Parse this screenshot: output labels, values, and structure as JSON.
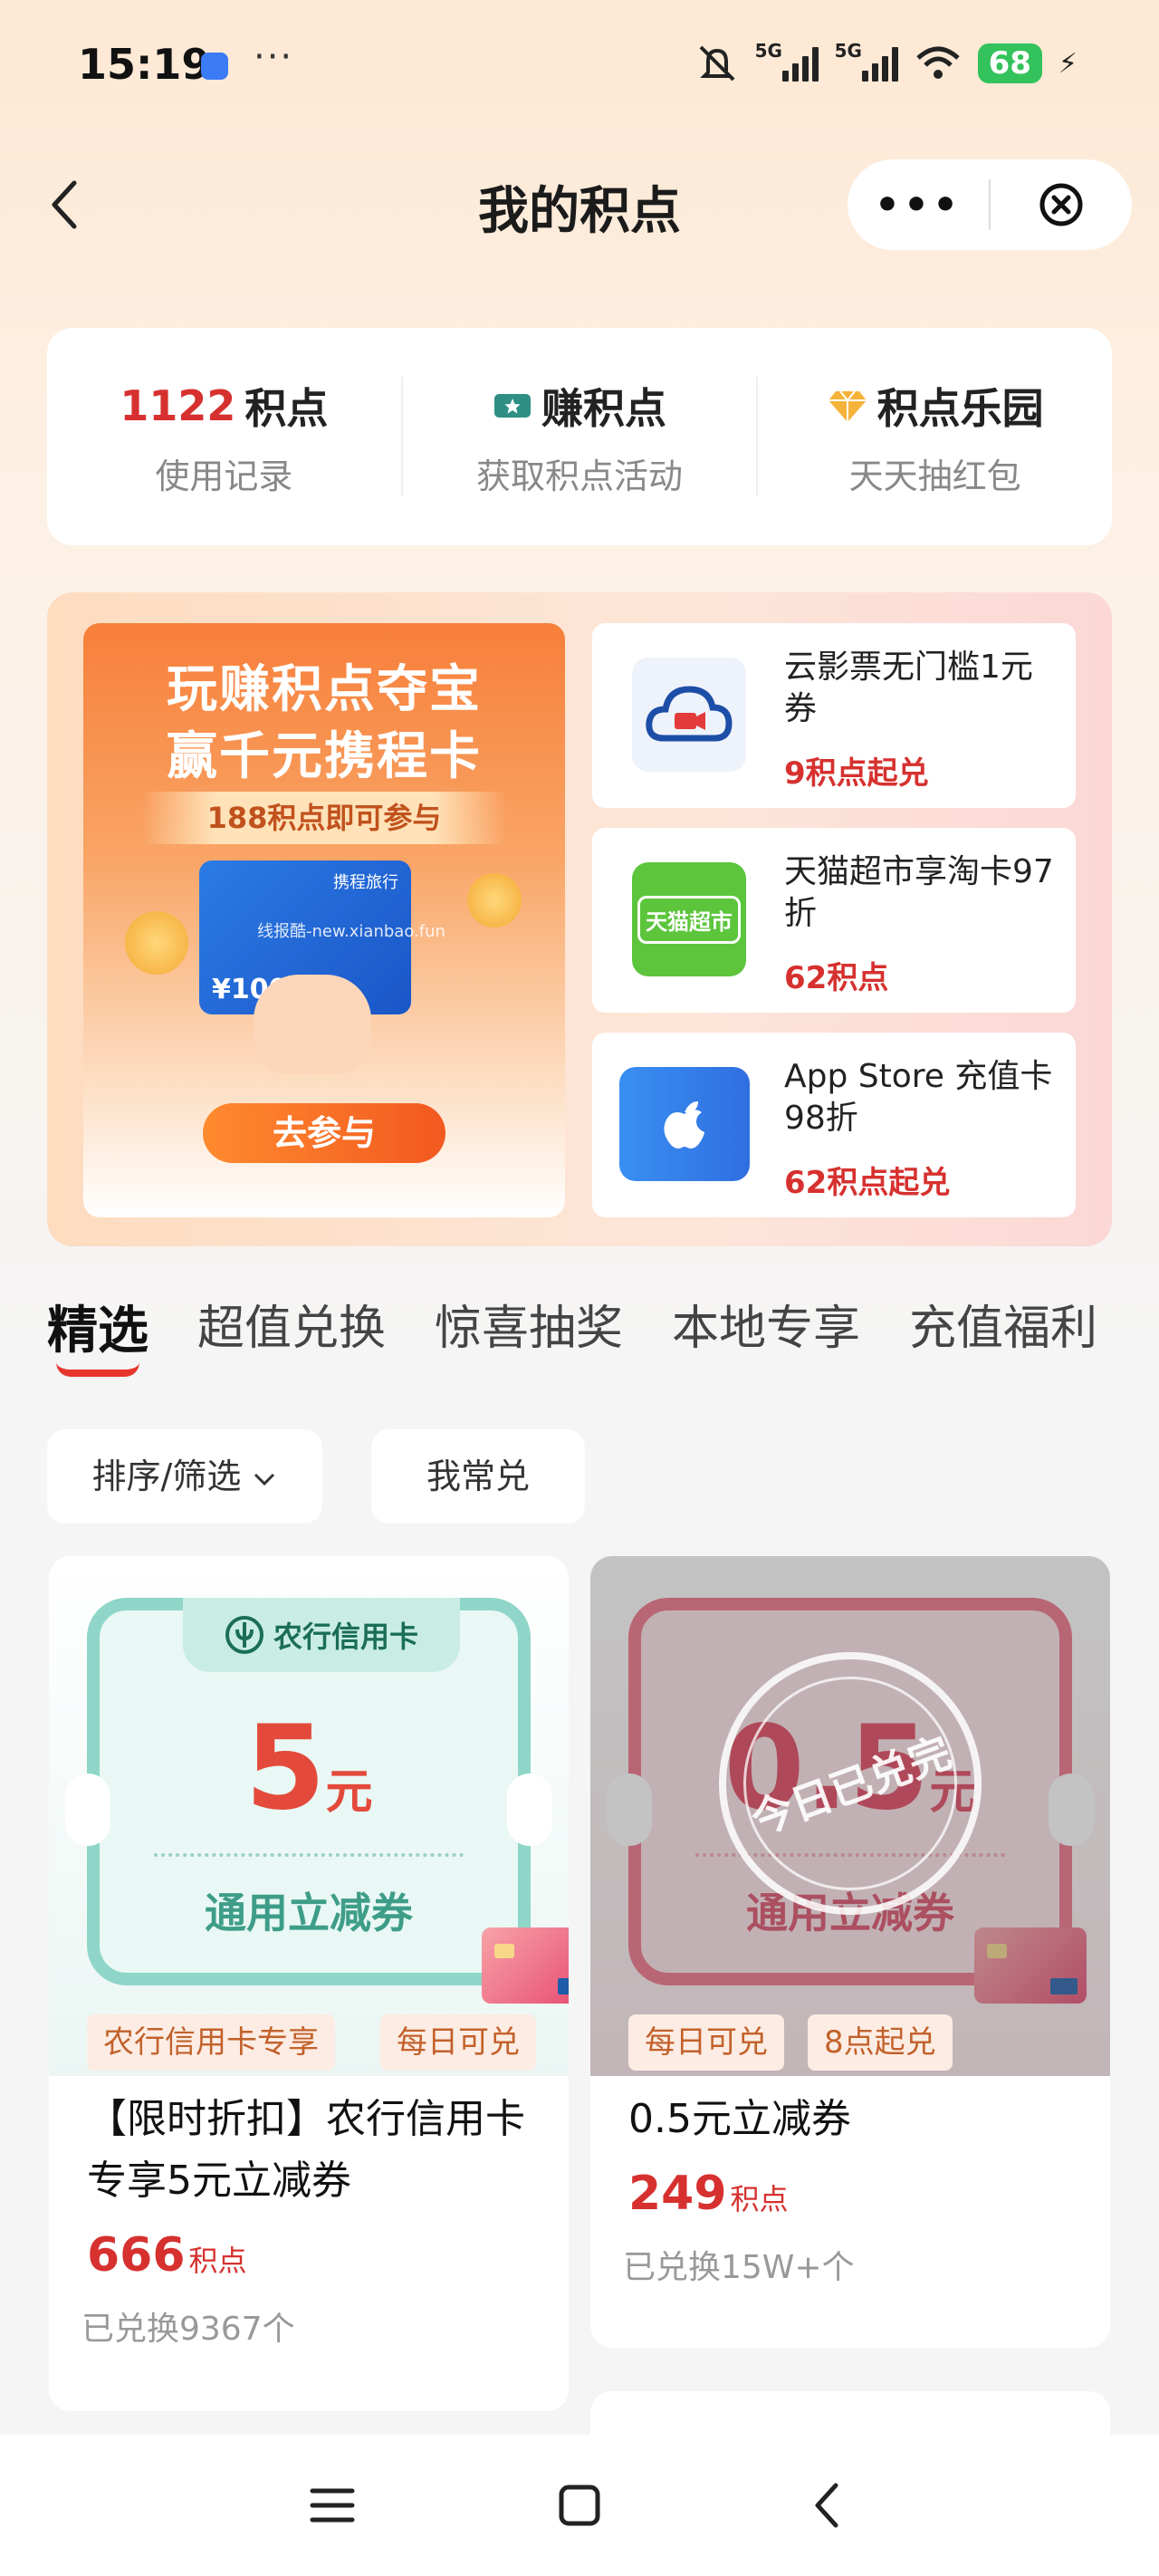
{
  "status_bar": {
    "time": "15:19",
    "dots": "···",
    "battery": "68",
    "signal1": "5G",
    "signal2": "5G"
  },
  "nav": {
    "title": "我的积点",
    "more": "•••"
  },
  "summary": {
    "points_value": "1122",
    "points_unit": "积点",
    "points_sub": "使用记录",
    "earn_label": "赚积点",
    "earn_sub": "获取积点活动",
    "park_label": "积点乐园",
    "park_sub": "天天抽红包"
  },
  "banner": {
    "line1": "玩赚积点夺宝",
    "line2": "赢千元携程卡",
    "ribbon": "188积点即可参与",
    "card_value": "¥1000",
    "card_brand": "携程旅行",
    "watermark": "线报酷-new.xianbao.fun",
    "button": "去参与"
  },
  "mini_items": [
    {
      "name": "云影票无门槛1元券",
      "pts": "9积点起兑",
      "icon": "cloud-movie-icon"
    },
    {
      "name": "天猫超市享淘卡97折",
      "pts": "62积点",
      "icon": "tmall-supermarket-icon",
      "icon_text": "天猫超市"
    },
    {
      "name": "App Store 充值卡98折",
      "pts": "62积点起兑",
      "icon": "apple-icon"
    }
  ],
  "tabs": [
    "精选",
    "超值兑换",
    "惊喜抽奖",
    "本地专享",
    "充值福利"
  ],
  "filters": {
    "sort": "排序/筛选",
    "frequent": "我常兑"
  },
  "products": [
    {
      "coupon_brand": "农行信用卡",
      "coupon_amount": "5",
      "coupon_unit": "元",
      "coupon_text": "通用立减券",
      "tags": [
        "农行信用卡专享",
        "每日可兑"
      ],
      "title": "【限时折扣】农行信用卡专享5元立减券",
      "price": "666",
      "price_unit": "积点",
      "sold": "已兑换9367个"
    },
    {
      "coupon_amount": "0.5",
      "coupon_unit": "元",
      "coupon_text": "通用立减券",
      "stamp": "今日已兑完",
      "tags": [
        "每日可兑",
        "8点起兑"
      ],
      "title": "0.5元立减券",
      "price": "249",
      "price_unit": "积点",
      "sold": "已兑换15W+个"
    }
  ],
  "colors": {
    "accent_red": "#d6312f",
    "battery_green": "#33c25b",
    "coupon_teal": "#8fd6c9",
    "coupon_pink": "#ef6e84"
  }
}
